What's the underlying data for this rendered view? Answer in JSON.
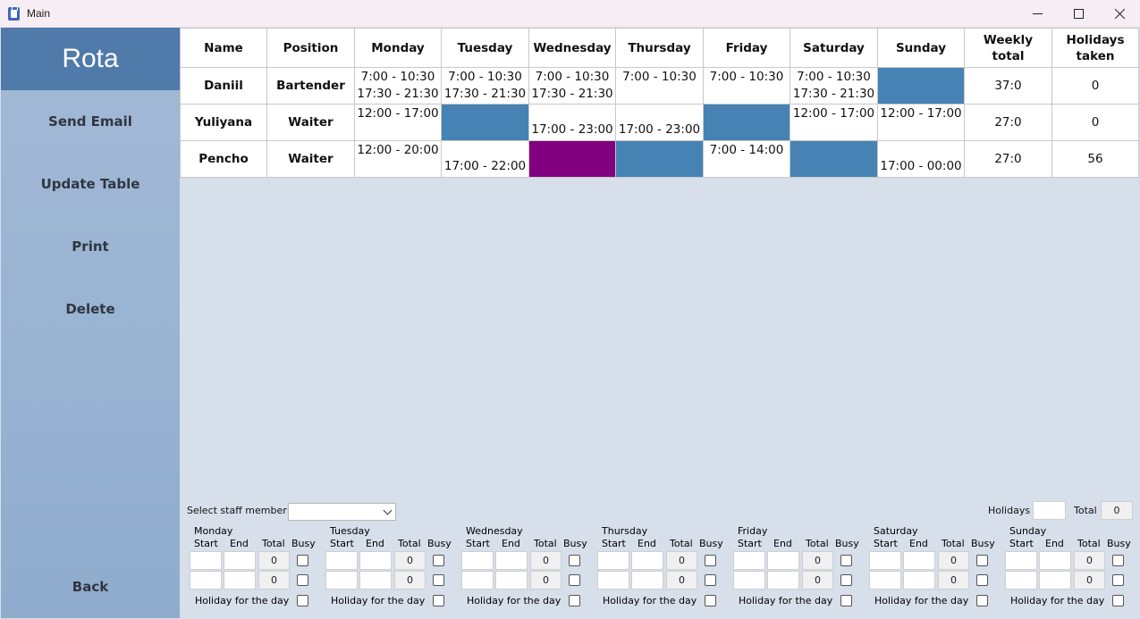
{
  "window": {
    "title": "Main"
  },
  "sidebar": {
    "title": "Rota",
    "buttons": [
      "Send Email",
      "Update Table",
      "Print",
      "Delete"
    ],
    "back_label": "Back"
  },
  "table": {
    "headers": [
      "Name",
      "Position",
      "Monday",
      "Tuesday",
      "Wednesday",
      "Thursday",
      "Friday",
      "Saturday",
      "Sunday",
      "Weekly total",
      "Holidays taken"
    ],
    "rows": [
      {
        "name": "Daniil",
        "position": "Bartender",
        "days": [
          {
            "lines": [
              "7:00 - 10:30",
              "17:30 - 21:30"
            ],
            "state": "shift-top"
          },
          {
            "lines": [
              "7:00 - 10:30",
              "17:30 - 21:30"
            ],
            "state": "shift-top"
          },
          {
            "lines": [
              "7:00 - 10:30",
              "17:30 - 21:30"
            ],
            "state": "shift-top"
          },
          {
            "lines": [
              "7:00 - 10:30"
            ],
            "state": "shift-top"
          },
          {
            "lines": [
              "7:00 - 10:30"
            ],
            "state": "shift-top"
          },
          {
            "lines": [
              "7:00 - 10:30",
              "17:30 - 21:30"
            ],
            "state": "shift-top"
          },
          {
            "lines": [],
            "state": "busy"
          }
        ],
        "weekly_total": "37:0",
        "holidays_taken": "0"
      },
      {
        "name": "Yuliyana",
        "position": "Waiter",
        "days": [
          {
            "lines": [
              "12:00 - 17:00"
            ],
            "state": "shift-top"
          },
          {
            "lines": [],
            "state": "busy"
          },
          {
            "lines": [
              "17:00 - 23:00"
            ],
            "state": "shift-bottom"
          },
          {
            "lines": [
              "17:00 - 23:00"
            ],
            "state": "shift-bottom"
          },
          {
            "lines": [],
            "state": "busy"
          },
          {
            "lines": [
              "12:00 - 17:00"
            ],
            "state": "shift-top"
          },
          {
            "lines": [
              "12:00 - 17:00"
            ],
            "state": "shift-top"
          }
        ],
        "weekly_total": "27:0",
        "holidays_taken": "0"
      },
      {
        "name": "Pencho",
        "position": "Waiter",
        "days": [
          {
            "lines": [
              "12:00 - 20:00"
            ],
            "state": "shift-top"
          },
          {
            "lines": [
              "17:00 - 22:00"
            ],
            "state": "shift-bottom"
          },
          {
            "lines": [],
            "state": "holiday"
          },
          {
            "lines": [],
            "state": "busy"
          },
          {
            "lines": [
              "7:00 - 14:00"
            ],
            "state": "shift-top"
          },
          {
            "lines": [],
            "state": "busy"
          },
          {
            "lines": [
              "17:00 - 00:00"
            ],
            "state": "shift-bottom"
          }
        ],
        "weekly_total": "27:0",
        "holidays_taken": "56"
      }
    ]
  },
  "colors": {
    "busy": "#4682b4",
    "holiday": "#800080"
  },
  "controls": {
    "select_staff_label": "Select staff member:",
    "select_staff_value": "",
    "holidays_label": "Holidays",
    "holidays_value": "",
    "total_label": "Total",
    "total_value": "0",
    "col_start": "Start",
    "col_end": "End",
    "col_total": "Total",
    "col_busy": "Busy",
    "holiday_label": "Holiday for the day",
    "days": [
      {
        "name": "Monday",
        "totals": [
          "0",
          "0"
        ]
      },
      {
        "name": "Tuesday",
        "totals": [
          "0",
          "0"
        ]
      },
      {
        "name": "Wednesday",
        "totals": [
          "0",
          "0"
        ]
      },
      {
        "name": "Thursday",
        "totals": [
          "0",
          "0"
        ]
      },
      {
        "name": "Friday",
        "totals": [
          "0",
          "0"
        ]
      },
      {
        "name": "Saturday",
        "totals": [
          "0",
          "0"
        ]
      },
      {
        "name": "Sunday",
        "totals": [
          "0",
          "0"
        ]
      }
    ]
  }
}
